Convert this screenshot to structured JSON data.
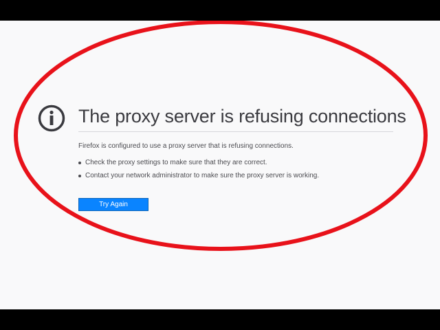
{
  "error_page": {
    "icon": "info-icon",
    "title": "The proxy server is refusing connections",
    "description": "Firefox is configured to use a proxy server that is refusing connections.",
    "suggestions": [
      "Check the proxy settings to make sure that they are correct.",
      "Contact your network administrator to make sure the proxy server is working."
    ],
    "try_again_label": "Try Again"
  },
  "colors": {
    "page_background": "#f9f9fa",
    "letterbox": "#000000",
    "title_text": "#3a3a3f",
    "body_text": "#4a4a4f",
    "button_background": "#0a84ff",
    "annotation_ellipse": "#e8121a"
  }
}
